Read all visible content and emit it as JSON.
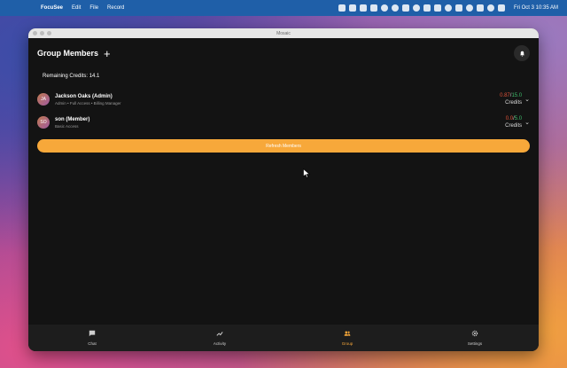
{
  "menubar": {
    "app_name": "FocuSee",
    "menus": [
      "Edit",
      "File",
      "Record"
    ],
    "clock": "Fri Oct 3  10:35 AM"
  },
  "window": {
    "title": "Mosaic"
  },
  "header": {
    "title": "Group Members",
    "add_icon": "plus-icon",
    "bell_icon": "bell-icon"
  },
  "credits": {
    "label": "Remaining Credits: 14.1"
  },
  "members": [
    {
      "initials": "JA",
      "name": "Jackson Oaks (Admin)",
      "permissions": "Admin • Full Access • Billing Manager",
      "used": "0.87",
      "limit": "15.0",
      "credits_label": "Credits"
    },
    {
      "initials": "SO",
      "name": "son (Member)",
      "permissions": "Basic Access",
      "used": "0.0",
      "limit": "5.0",
      "credits_label": "Credits"
    }
  ],
  "refresh_button": "Refresh Members",
  "nav": [
    {
      "label": "Chat",
      "icon": "chat-icon",
      "active": false
    },
    {
      "label": "Activity",
      "icon": "activity-icon",
      "active": false
    },
    {
      "label": "Group",
      "icon": "group-icon",
      "active": true
    },
    {
      "label": "Settings",
      "icon": "settings-icon",
      "active": false
    }
  ],
  "colors": {
    "accent": "#f7a83a",
    "used": "#e0533a",
    "limit": "#3dbb6a",
    "background": "#131313"
  }
}
